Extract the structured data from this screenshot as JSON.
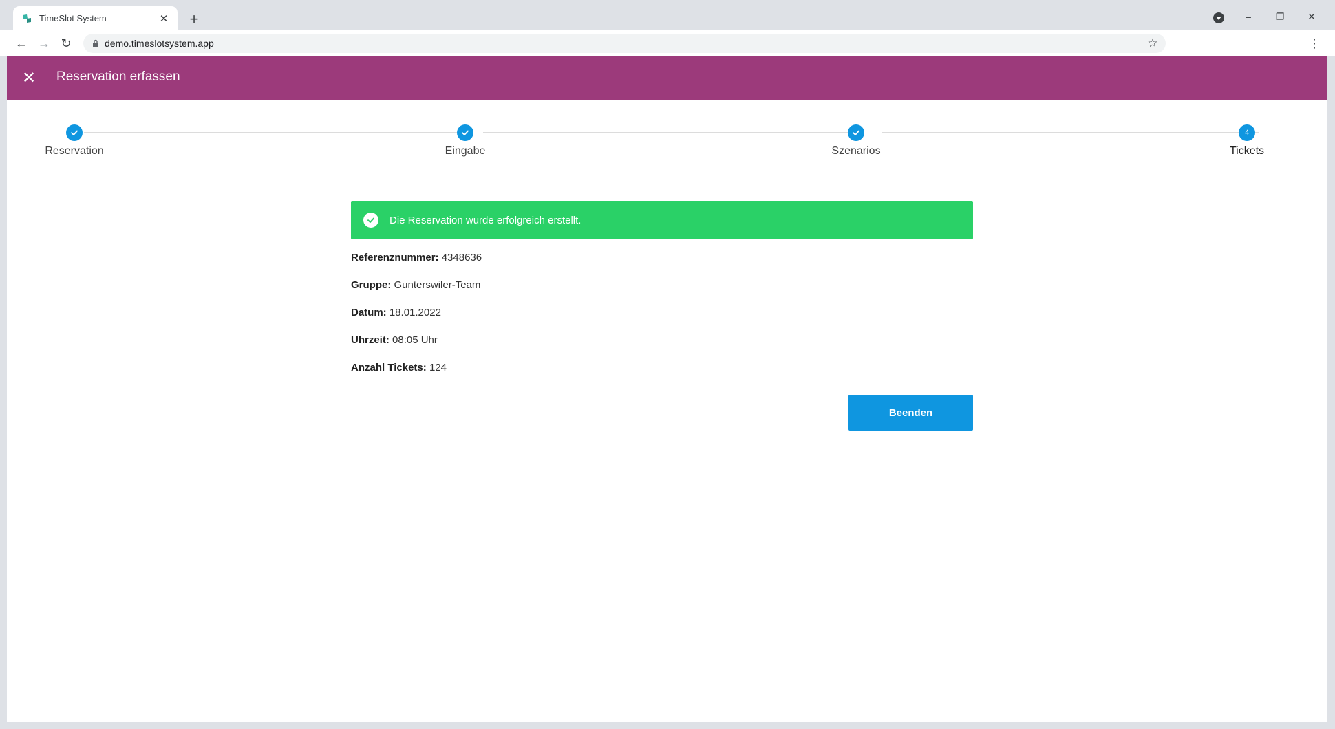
{
  "browser": {
    "tab_title": "TimeSlot System",
    "tab_close": "✕",
    "new_tab": "+",
    "url": "demo.timeslotsystem.app",
    "back": "←",
    "forward": "→",
    "reload": "↻",
    "star": "☆",
    "menu": "⋮",
    "minimize": "–",
    "restore": "❐",
    "close": "✕"
  },
  "appbar": {
    "close": "✕",
    "title": "Reservation erfassen"
  },
  "stepper": {
    "steps": [
      {
        "label": "Reservation",
        "state": "done"
      },
      {
        "label": "Eingabe",
        "state": "done"
      },
      {
        "label": "Szenarios",
        "state": "done"
      },
      {
        "label": "Tickets",
        "state": "active",
        "number": "4"
      }
    ]
  },
  "success": {
    "message": "Die Reservation wurde erfolgreich erstellt."
  },
  "details": [
    {
      "key": "Referenznummer:",
      "value": "4348636"
    },
    {
      "key": "Gruppe:",
      "value": "Gunterswiler-Team"
    },
    {
      "key": "Datum:",
      "value": "18.01.2022"
    },
    {
      "key": "Uhrzeit:",
      "value": "08:05 Uhr"
    },
    {
      "key": "Anzahl Tickets:",
      "value": "124"
    }
  ],
  "actions": {
    "finish_label": "Beenden"
  },
  "colors": {
    "appbar": "#9c3a7b",
    "primary": "#0f96e0",
    "success": "#2ad167"
  }
}
